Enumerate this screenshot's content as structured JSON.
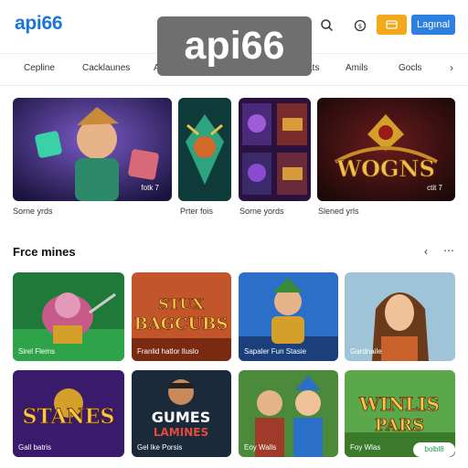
{
  "header": {
    "logo": "api66",
    "login_label": "Lagınal",
    "watermark": "api66",
    "icons": [
      "search-icon",
      "coin-icon",
      "wallet-icon"
    ]
  },
  "nav": {
    "items": [
      "Cepline",
      "Cacklaunes",
      "Ar",
      "Ats",
      "Amils",
      "Gocls"
    ],
    "next_icon": "chevron-right-icon"
  },
  "featured": [
    {
      "caption": "Sorne yrds",
      "overlay": "fotk 7"
    },
    {
      "caption": "Prter fois",
      "overlay": ""
    },
    {
      "caption": "Sorne yords",
      "overlay": ""
    },
    {
      "caption": "Slened yrls",
      "overlay": "ctit 7",
      "art_text": "WOGNS"
    }
  ],
  "section": {
    "title": "Frce mines",
    "prev_icon": "chevron-left-icon",
    "more_icon": "more-icon"
  },
  "games": [
    {
      "caption": "Sirel Flems",
      "art_text": ""
    },
    {
      "caption": "Franlid hatlor lluslo",
      "art_text": "STUX BAGCUBS"
    },
    {
      "caption": "Sapaler Fun Stasie",
      "art_text": ""
    },
    {
      "caption": "Gardnaile",
      "art_text": ""
    },
    {
      "caption": "Gall batris",
      "art_text": "STANES"
    },
    {
      "caption": "Gel lke Porsis",
      "art_text": "GUMES LAMINES"
    },
    {
      "caption": "Eoy Walls",
      "art_text": ""
    },
    {
      "caption": "Foy Wlas",
      "art_text": "WINLIS PARS",
      "badge": "bolbl8"
    }
  ],
  "colors": {
    "accent": "#2d7fe0",
    "deposit": "#f4a81c",
    "logo": "#1b74d8"
  }
}
